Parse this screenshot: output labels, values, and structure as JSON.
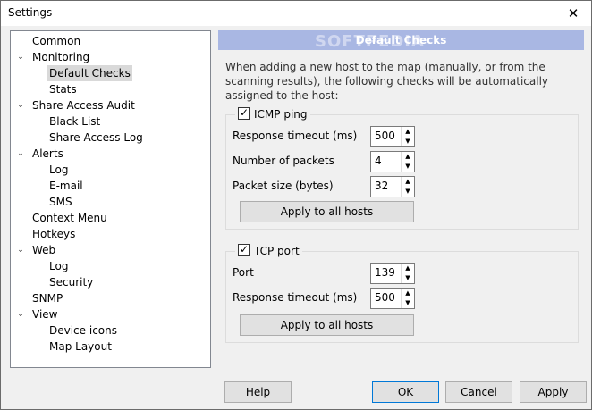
{
  "window": {
    "title": "Settings",
    "close_glyph": "✕"
  },
  "tree": {
    "items": [
      {
        "label": "Common",
        "level": 0
      },
      {
        "label": "Monitoring",
        "level": 0,
        "expanded": true
      },
      {
        "label": "Default Checks",
        "level": 1,
        "selected": true
      },
      {
        "label": "Stats",
        "level": 1
      },
      {
        "label": "Share Access Audit",
        "level": 0,
        "expanded": true
      },
      {
        "label": "Black List",
        "level": 1
      },
      {
        "label": "Share Access Log",
        "level": 1
      },
      {
        "label": "Alerts",
        "level": 0,
        "expanded": true
      },
      {
        "label": "Log",
        "level": 1
      },
      {
        "label": "E-mail",
        "level": 1
      },
      {
        "label": "SMS",
        "level": 1
      },
      {
        "label": "Context Menu",
        "level": 0
      },
      {
        "label": "Hotkeys",
        "level": 0
      },
      {
        "label": "Web",
        "level": 0,
        "expanded": true
      },
      {
        "label": "Log",
        "level": 1
      },
      {
        "label": "Security",
        "level": 1
      },
      {
        "label": "SNMP",
        "level": 0
      },
      {
        "label": "View",
        "level": 0,
        "expanded": true
      },
      {
        "label": "Device icons",
        "level": 1
      },
      {
        "label": "Map Layout",
        "level": 1
      }
    ]
  },
  "panel": {
    "header": "Default Checks",
    "watermark": "SOFTPEDIA",
    "description": "When adding a new host to the map (manually, or from the scanning results), the following checks will be automatically assigned to the host:",
    "icmp": {
      "label": "ICMP ping",
      "checked": true,
      "fields": [
        {
          "label": "Response timeout (ms)",
          "value": "500"
        },
        {
          "label": "Number of packets",
          "value": "4"
        },
        {
          "label": "Packet size (bytes)",
          "value": "32"
        }
      ],
      "apply_label": "Apply to all hosts"
    },
    "tcp": {
      "label": "TCP port",
      "checked": true,
      "fields": [
        {
          "label": "Port",
          "value": "139"
        },
        {
          "label": "Response timeout (ms)",
          "value": "500"
        }
      ],
      "apply_label": "Apply to all hosts"
    }
  },
  "buttons": {
    "help": "Help",
    "ok": "OK",
    "cancel": "Cancel",
    "apply": "Apply"
  }
}
